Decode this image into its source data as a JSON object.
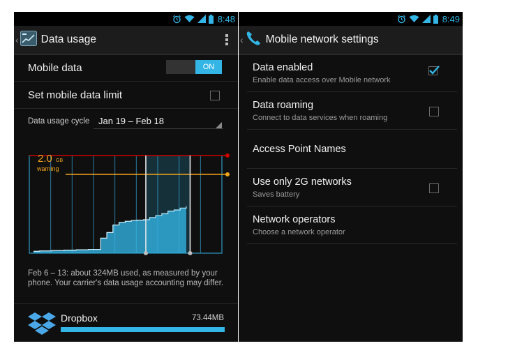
{
  "left": {
    "status_time": "8:48",
    "title": "Data usage",
    "mobile_data_label": "Mobile data",
    "mobile_data_toggle": "ON",
    "set_limit_label": "Set mobile data limit",
    "set_limit_checked": false,
    "cycle_label": "Data usage cycle",
    "cycle_value": "Jan 19 – Feb 18",
    "chart_data": {
      "type": "area",
      "warning_value": "2.0",
      "warning_unit": "GB",
      "warning_label": "warning",
      "limit_color": "#cc0000",
      "warning_color": "#f2a41a",
      "series_color": "#33b5e5",
      "selected_range": "Feb 6 – 13",
      "cumulative_usage": [
        0.05,
        0.06,
        0.06,
        0.07,
        0.07,
        0.08,
        0.08,
        0.09,
        0.09,
        0.1,
        0.1,
        0.4,
        0.55,
        0.75,
        0.82,
        0.85,
        0.87,
        0.88,
        0.89,
        0.95,
        1.0,
        1.05,
        1.12,
        1.15,
        1.2,
        1.25
      ]
    },
    "note": "Feb 6 – 13: about 324MB used, as measured by your phone. Your carrier's data usage accounting may differ.",
    "app": {
      "name": "Dropbox",
      "size": "73.44MB",
      "fraction": 1.0
    }
  },
  "right": {
    "status_time": "8:49",
    "title": "Mobile network settings",
    "items": [
      {
        "primary": "Data enabled",
        "secondary": "Enable data access over Mobile network",
        "checkbox": true,
        "checked": true
      },
      {
        "primary": "Data roaming",
        "secondary": "Connect to data services when roaming",
        "checkbox": true,
        "checked": false
      },
      {
        "primary": "Access Point Names",
        "secondary": "",
        "checkbox": false,
        "checked": false
      },
      {
        "primary": "Use only 2G networks",
        "secondary": "Saves battery",
        "checkbox": true,
        "checked": false
      },
      {
        "primary": "Network operators",
        "secondary": "Choose a network operator",
        "checkbox": false,
        "checked": false
      }
    ]
  },
  "icons": {
    "status": [
      "alarm-icon",
      "wifi-icon",
      "signal-icon",
      "battery-icon"
    ],
    "left_app_icon": "data-usage-app-icon",
    "right_app_icon": "phone-app-icon",
    "overflow": "overflow-menu-icon",
    "app_row_icon": "dropbox-icon"
  }
}
